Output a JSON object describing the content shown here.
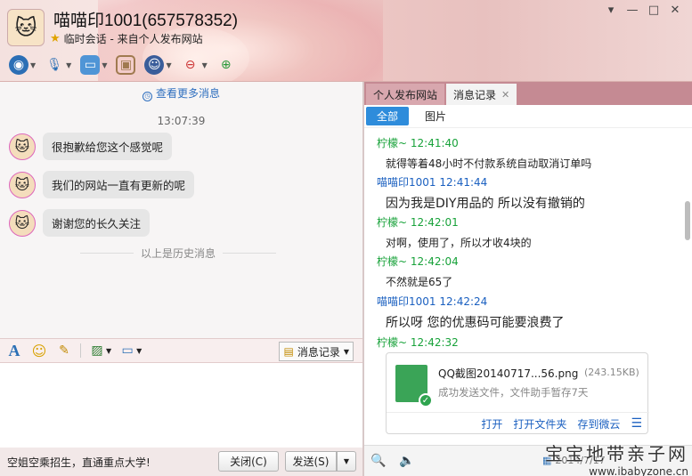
{
  "window": {
    "title": "喵喵印1001(657578352)",
    "subtitle": "临时会话 - 来自个人发布网站",
    "controls": [
      "▾",
      "—",
      "□",
      "✕"
    ]
  },
  "toolbar": {
    "items": [
      "video-call-icon",
      "voice-call-icon",
      "transfer-file-icon",
      "remote-desktop-icon",
      "webcam-avatar-icon",
      "block-user-icon",
      "add-friend-icon"
    ]
  },
  "chat": {
    "view_more": "查看更多消息",
    "timestamp": "13:07:39",
    "messages": [
      {
        "text": "很抱歉给您这个感觉呢"
      },
      {
        "text": "我们的网站一直有更新的呢"
      },
      {
        "text": "谢谢您的长久关注"
      }
    ],
    "history_divider": "以上是历史消息"
  },
  "compose_toolbar": {
    "font_icon": "A",
    "emoji_icon": "☺",
    "history_button": "消息记录"
  },
  "footer": {
    "ad_text": "空姐空乘招生，直通重点大学!",
    "close_button": "关闭(C)",
    "send_button": "发送(S)"
  },
  "right_panel": {
    "tabs": [
      {
        "label": "个人发布网站",
        "active": false
      },
      {
        "label": "消息记录",
        "active": true,
        "close": "✕"
      }
    ],
    "filters": [
      {
        "label": "全部",
        "active": true
      },
      {
        "label": "图片",
        "active": false
      }
    ],
    "log": [
      {
        "sender": "柠檬~",
        "time": "12:41:40",
        "color": "#18a23a"
      },
      {
        "text": "就得等着48小时不付款系统自动取消订单吗"
      },
      {
        "sender": "喵喵印1001",
        "time": "12:41:44",
        "color": "#1b60c0"
      },
      {
        "text": "因为我是DIY用品的 所以没有撤销的"
      },
      {
        "sender": "柠檬~",
        "time": "12:42:01",
        "color": "#18a23a"
      },
      {
        "text": "对啊，使用了，所以才收4块的"
      },
      {
        "sender": "柠檬~",
        "time": "12:42:04",
        "color": "#18a23a"
      },
      {
        "text": "不然就是65了"
      },
      {
        "sender": "喵喵印1001",
        "time": "12:42:24",
        "color": "#1b60c0"
      },
      {
        "text": "所以呀  您的优惠码可能要浪费了"
      },
      {
        "sender": "柠檬~",
        "time": "12:42:32",
        "color": "#18a23a"
      }
    ],
    "file": {
      "name": "QQ截图20140717...56.png",
      "size": "(243.15KB)",
      "status": "成功发送文件，文件助手暂存7天",
      "actions": [
        "打开",
        "打开文件夹",
        "存到微云"
      ]
    },
    "date": "2014/7/17"
  },
  "watermark": {
    "cn": "宝宝地带亲子网",
    "en": "www.ibabyzone.cn"
  }
}
